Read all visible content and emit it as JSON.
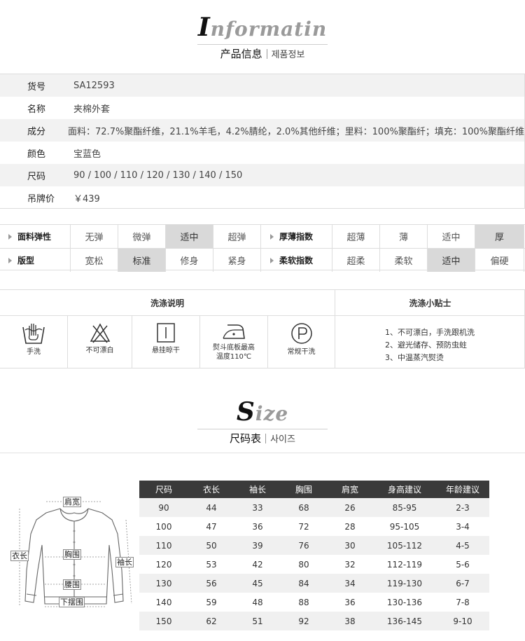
{
  "info_heading": {
    "title_cap": "I",
    "title_rest": "nformatin",
    "subtitle_cn": "产品信息",
    "subtitle_ko": "제품정보"
  },
  "info": [
    {
      "label": "货号",
      "value": "SA12593"
    },
    {
      "label": "名称",
      "value": "夹棉外套"
    },
    {
      "label": "成分",
      "value": "面料：72.7%聚酯纤维，21.1%羊毛，4.2%腈纶，2.0%其他纤维；里料：100%聚酯纤；填充：100%聚酯纤维"
    },
    {
      "label": "颜色",
      "value": "宝蓝色"
    },
    {
      "label": "尺码",
      "value": "90 / 100 / 110  / 120  / 130  / 140 / 150"
    },
    {
      "label": "吊牌价",
      "value": "￥439"
    }
  ],
  "attributes": [
    {
      "label": "面料弹性",
      "options": [
        "无弹",
        "微弹",
        "适中",
        "超弹"
      ],
      "selected": "适中"
    },
    {
      "label": "厚薄指数",
      "options": [
        "超薄",
        "薄",
        "适中",
        "厚"
      ],
      "selected": "厚"
    },
    {
      "label": "版型",
      "options": [
        "宽松",
        "标准",
        "修身",
        "紧身"
      ],
      "selected": "标准"
    },
    {
      "label": "柔软指数",
      "options": [
        "超柔",
        "柔软",
        "适中",
        "偏硬"
      ],
      "selected": "适中"
    }
  ],
  "wash": {
    "title": "洗涤说明",
    "tips_title": "洗涤小贴士",
    "icons": [
      {
        "icon": "hand-wash-icon",
        "label": "手洗"
      },
      {
        "icon": "no-bleach-icon",
        "label": "不可漂白"
      },
      {
        "icon": "hang-dry-icon",
        "label": "悬挂晾干"
      },
      {
        "icon": "iron-icon",
        "label": "熨斗底板最高",
        "label2": "温度110℃"
      },
      {
        "icon": "dry-clean-icon",
        "label": "常规干洗"
      }
    ],
    "tips": [
      "1、不可漂白，手洗跟机洗",
      "2、避光储存、预防虫蛀",
      "3、中温蒸汽熨烫"
    ]
  },
  "size_heading": {
    "title_cap": "S",
    "title_rest": "ize",
    "subtitle_cn": "尺码表",
    "subtitle_ko": "사이즈"
  },
  "diagram_labels": {
    "shoulder": "肩宽",
    "length": "衣长",
    "chest": "胸围",
    "sleeve": "袖长",
    "waist": "腰围",
    "hem": "下摆围"
  },
  "size_table": {
    "headers": [
      "尺码",
      "衣长",
      "袖长",
      "胸围",
      "肩宽",
      "身高建议",
      "年龄建议"
    ],
    "rows": [
      [
        "90",
        "44",
        "33",
        "68",
        "26",
        "85-95",
        "2-3"
      ],
      [
        "100",
        "47",
        "36",
        "72",
        "28",
        "95-105",
        "3-4"
      ],
      [
        "110",
        "50",
        "39",
        "76",
        "30",
        "105-112",
        "4-5"
      ],
      [
        "120",
        "53",
        "42",
        "80",
        "32",
        "112-119",
        "5-6"
      ],
      [
        "130",
        "56",
        "45",
        "84",
        "34",
        "119-130",
        "6-7"
      ],
      [
        "140",
        "59",
        "48",
        "88",
        "36",
        "130-136",
        "7-8"
      ],
      [
        "150",
        "62",
        "51",
        "92",
        "38",
        "136-145",
        "9-10"
      ]
    ]
  }
}
